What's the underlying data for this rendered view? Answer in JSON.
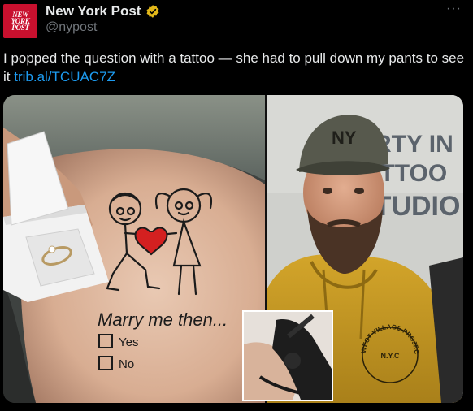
{
  "account": {
    "display_name": "New York Post",
    "handle": "@nypost",
    "avatar_text": [
      "NEW",
      "YORK",
      "POST"
    ],
    "verified_icon": "verified-badge-icon",
    "more_icon": "more-options-icon",
    "more_label": "···"
  },
  "tweet": {
    "text": "I popped the question with a tattoo — she had to pull down my pants to see it ",
    "link": "trib.al/TCUAC7Z"
  },
  "media": {
    "left_photo": {
      "tattoo_text": {
        "line1": "Marry me then...",
        "option_yes": "Yes",
        "option_no": "No"
      }
    },
    "right_photo": {
      "studio_sign": [
        "ERTY IN",
        "ATTOO",
        "STUDIO"
      ],
      "cap_logo": "NY",
      "hoodie_text": [
        "WEST VILLAGE PROJECTS",
        "N.Y.C"
      ]
    }
  },
  "colors": {
    "background": "#000000",
    "text": "#e7e9ea",
    "secondary": "#71767b",
    "link": "#1d9bf0",
    "brand_red": "#c8102e",
    "verified_gold": "#e2b719"
  }
}
